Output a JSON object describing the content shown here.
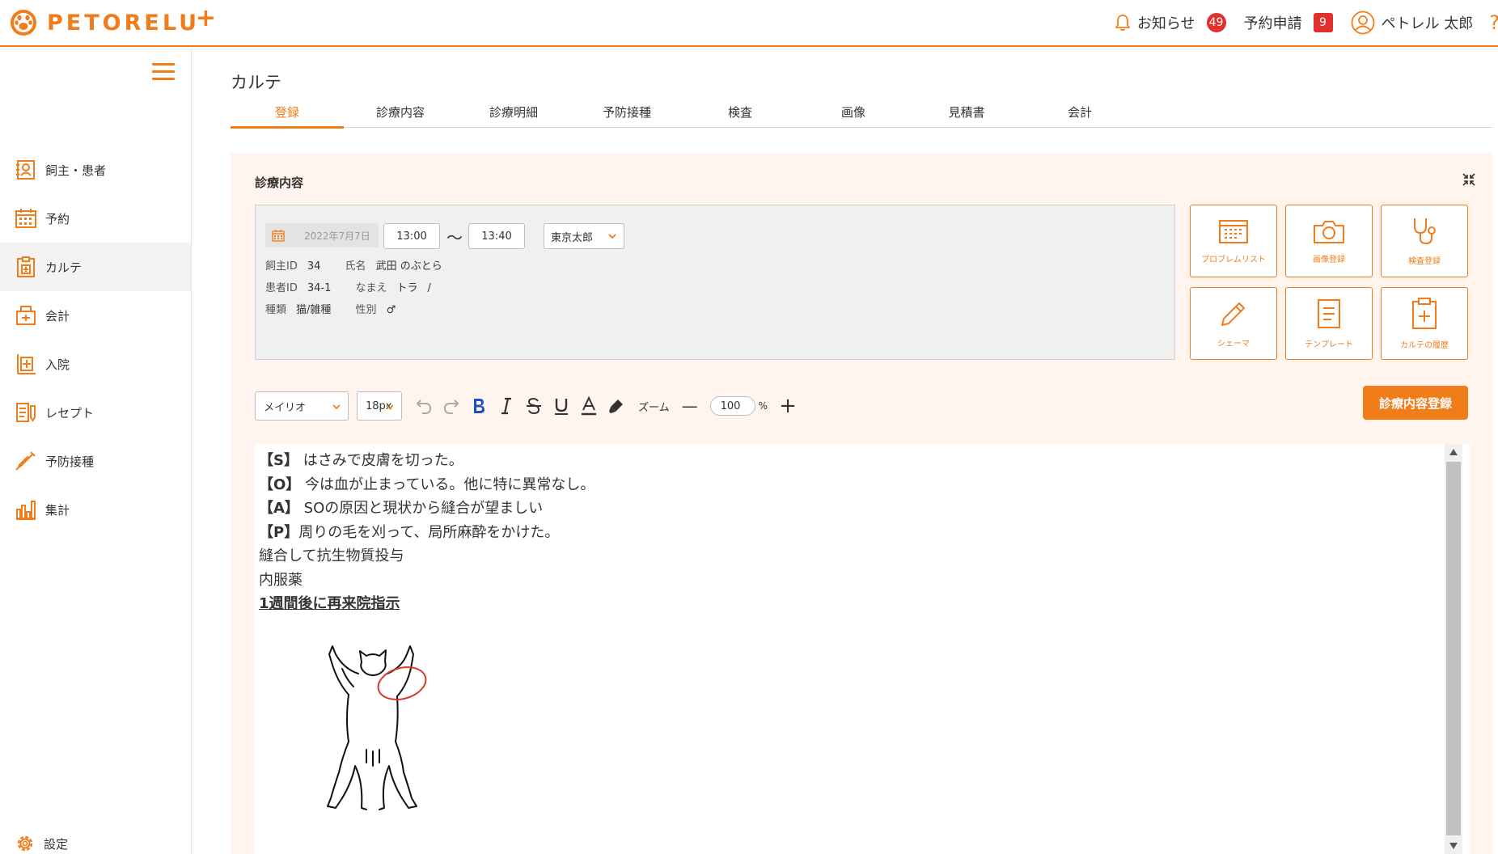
{
  "header": {
    "logo_text": "PETORELU",
    "logo_plus": "+",
    "notifications_label": "お知らせ",
    "notifications_count": "49",
    "reservations_label": "予約申請",
    "reservations_count": "9",
    "user_name": "ペトレル 太郎",
    "help_label": "?",
    "accent_color": "#f07d1a"
  },
  "sidebar": {
    "items": [
      {
        "label": "飼主・患者",
        "icon": "owner-patient-icon"
      },
      {
        "label": "予約",
        "icon": "calendar-icon"
      },
      {
        "label": "カルテ",
        "icon": "chart-clipboard-icon",
        "active": true
      },
      {
        "label": "会計",
        "icon": "register-icon"
      },
      {
        "label": "入院",
        "icon": "hospital-icon"
      },
      {
        "label": "レセプト",
        "icon": "receipt-icon"
      },
      {
        "label": "予防接種",
        "icon": "syringe-icon"
      },
      {
        "label": "集計",
        "icon": "bar-chart-icon"
      }
    ],
    "settings_label": "設定"
  },
  "main": {
    "title": "カルテ",
    "tabs": [
      "登録",
      "診療内容",
      "診療明細",
      "予防接種",
      "検査",
      "画像",
      "見積書",
      "会計"
    ],
    "active_tab": "登録",
    "panel_title": "診療内容",
    "visit": {
      "date": "2022年7月7日",
      "start_time": "13:00",
      "separator": "〜",
      "end_time": "13:40",
      "staff": "東京太郎"
    },
    "patient": {
      "owner_id_label": "飼主ID",
      "owner_id": "34",
      "owner_name_label": "氏名",
      "owner_name": "武田 のぶとら",
      "patient_id_label": "患者ID",
      "patient_id": "34-1",
      "pet_name_label": "なまえ",
      "pet_name": "トラ",
      "pet_name_suffix": "/",
      "species_label": "種類",
      "species": "猫/雑種",
      "sex_label": "性別",
      "sex": "♂"
    },
    "actions": {
      "problem_list": "プロブレムリスト",
      "image_register": "画像登録",
      "exam_register": "検査登録",
      "schema": "シェーマ",
      "template": "テンプレート",
      "chart_history": "カルテの履歴"
    },
    "toolbar": {
      "font": "メイリオ",
      "size": "18px",
      "zoom_label": "ズーム",
      "zoom_value": "100",
      "zoom_unit": "%",
      "minus": "—",
      "plus": "+",
      "register_button": "診療内容登録"
    },
    "editor": {
      "lines": [
        {
          "tag": "【S】",
          "text": "はさみで皮膚を切った。"
        },
        {
          "tag": "【O】",
          "text": "今は血が止まっている。他に特に異常なし。"
        },
        {
          "tag": "【A】",
          "text": "SOの原因と現状から縫合が望ましい"
        },
        {
          "tag": "【P】",
          "text": "周りの毛を刈って、局所麻酔をかけた。"
        },
        {
          "tag": "",
          "text": "縫合して抗生物質投与"
        },
        {
          "tag": "",
          "text": "内服薬"
        },
        {
          "tag": "",
          "text": "1週間後に再来院指示"
        }
      ],
      "drawing": "cat-schema-drawing"
    }
  }
}
